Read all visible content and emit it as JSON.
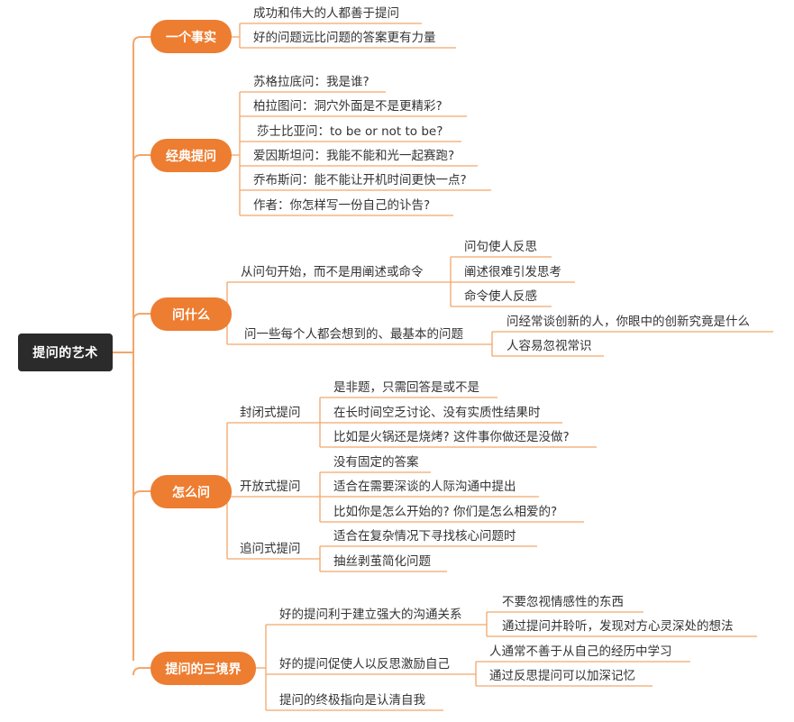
{
  "root": "提问的艺术",
  "branches": [
    {
      "label": "一个事实",
      "leaves": [
        "成功和伟大的人都善于提问",
        "好的问题远比问题的答案更有力量"
      ]
    },
    {
      "label": "经典提问",
      "leaves": [
        "苏格拉底问：我是谁?",
        "柏拉图问：洞穴外面是不是更精彩?",
        "莎士比亚问：to be or not to be?",
        "爱因斯坦问：我能不能和光一起赛跑?",
        "乔布斯问：能不能让开机时间更快一点?",
        "作者：你怎样写一份自己的讣告?"
      ]
    },
    {
      "label": "问什么",
      "subs": [
        {
          "label": "从问句开始，而不是用阐述或命令",
          "leaves": [
            "问句使人反思",
            "阐述很难引发思考",
            "命令使人反感"
          ]
        },
        {
          "label": "问一些每个人都会想到的、最基本的问题",
          "leaves": [
            "问经常谈创新的人，你眼中的创新究竟是什么",
            "人容易忽视常识"
          ]
        }
      ]
    },
    {
      "label": "怎么问",
      "subs": [
        {
          "label": "封闭式提问",
          "leaves": [
            "是非题，只需回答是或不是",
            "在长时间空乏讨论、没有实质性结果时",
            "比如是火锅还是烧烤? 这件事你做还是没做?"
          ]
        },
        {
          "label": "开放式提问",
          "leaves": [
            "没有固定的答案",
            "适合在需要深谈的人际沟通中提出",
            "比如你是怎么开始的? 你们是怎么相爱的?"
          ]
        },
        {
          "label": "追问式提问",
          "leaves": [
            "适合在复杂情况下寻找核心问题时",
            "抽丝剥茧简化问题"
          ]
        }
      ]
    },
    {
      "label": "提问的三境界",
      "subs": [
        {
          "label": "好的提问利于建立强大的沟通关系",
          "leaves": [
            "不要忽视情感性的东西",
            "通过提问并聆听，发现对方心灵深处的想法"
          ]
        },
        {
          "label": "好的提问促使人以反思激励自己",
          "leaves": [
            "人通常不善于从自己的经历中学习",
            "通过反思提问可以加深记忆"
          ]
        },
        {
          "label": "提问的终极指向是认清自我",
          "leaves": []
        }
      ]
    }
  ],
  "colors": {
    "accent": "#ed7d31",
    "root_bg": "#2b2b2b",
    "line": "#f2a66b"
  }
}
